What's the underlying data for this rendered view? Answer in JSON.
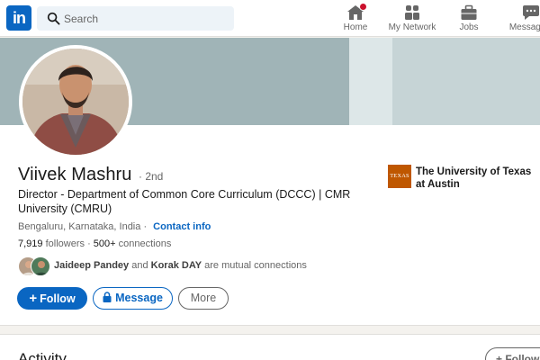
{
  "brand": {
    "logo_text": "in",
    "accent": "#0a66c2"
  },
  "search": {
    "placeholder": "Search",
    "value": ""
  },
  "nav": [
    {
      "label": "Home",
      "icon": "home-icon",
      "has_notification": true
    },
    {
      "label": "My Network",
      "icon": "people-icon"
    },
    {
      "label": "Jobs",
      "icon": "briefcase-icon"
    },
    {
      "label": "Messaging",
      "icon": "chat-bubble-icon"
    }
  ],
  "profile": {
    "name": "Viivek Mashru",
    "degree": "· 2nd",
    "headline": "Director - Department of Common Core Curriculum (DCCC) | CMR University (CMRU)",
    "location": "Bengaluru, Karnataka, India",
    "location_separator": "·",
    "contact_link": "Contact info",
    "followers_count": "7,919",
    "followers_label": "followers",
    "connections_separator": "·",
    "connections_count": "500+",
    "connections_label": "connections",
    "mutual": {
      "first": "Jaideep Pandey",
      "joiner": "and",
      "second": "Korak DAY",
      "suffix": "are mutual connections"
    },
    "education": {
      "logo_text": "TEXAS",
      "name": "The University of Texas at Austin",
      "logo_color": "#bf5700"
    }
  },
  "actions": {
    "follow": "Follow",
    "message": "Message",
    "more": "More"
  },
  "activity": {
    "title": "Activity",
    "follow_button": "Follow"
  }
}
